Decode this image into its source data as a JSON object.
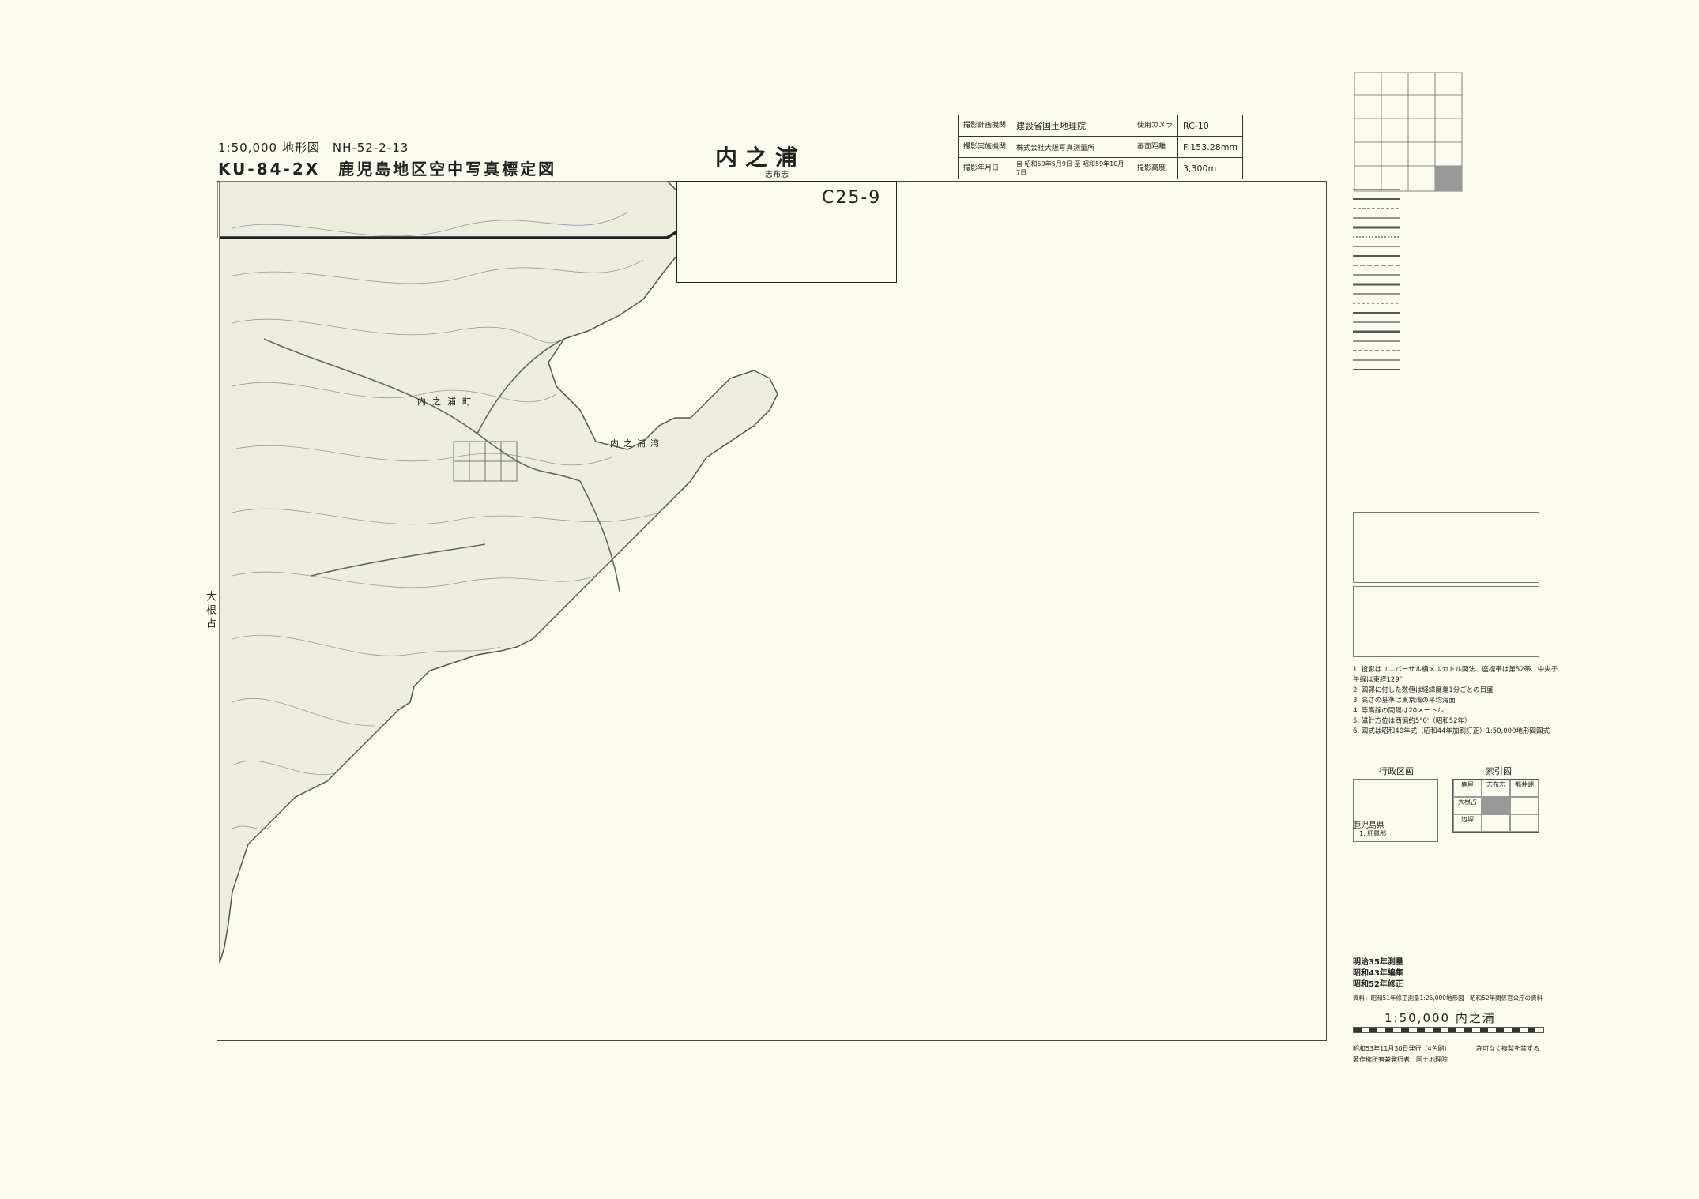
{
  "header": {
    "series_line": "1:50,000 地形図　NH-52-2-13",
    "code_line": "KU-84-2X　鹿児島地区空中写真標定図",
    "map_name": "内之浦",
    "map_name_reading": "志布志"
  },
  "photo_info": {
    "rows": [
      {
        "label": "撮影計画機関",
        "value": "建設省国土地理院",
        "label2": "使用カメラ",
        "value2": "RC-10"
      },
      {
        "label": "撮影実施機関",
        "value": "株式会社大阪写真測量所",
        "label2": "画面距離",
        "value2": "F:153.28mm"
      },
      {
        "label": "撮影年月日",
        "value": "自 昭和59年5月9日 至 昭和59年10月7日",
        "label2": "撮影高度",
        "value2": "3,300m"
      }
    ]
  },
  "map": {
    "sheet_code": "C25-9",
    "bay_label": "内之浦湾",
    "side_label": "大根占",
    "town_label": "内之浦町"
  },
  "notes": [
    "1. 投影はユニバーサル横メルカトル図法、座標帯は第52帯、中央子午線は東経129°",
    "2. 図郭に付した数値は経緯度差1分ごとの目盛",
    "3. 高さの基準は東京湾の平均海面",
    "4. 等高線の間隔は20メートル",
    "5. 磁針方位は西偏約5°0'（昭和52年）",
    "6. 図式は昭和40年式（昭和44年加刷訂正）1:50,000地形図図式"
  ],
  "admin": {
    "title": "行政区画",
    "prefecture": "鹿児島県",
    "sub": "1. 肝属郡"
  },
  "index_map": {
    "title": "索引図",
    "cells": [
      "鹿屋",
      "志布志",
      "都井岬",
      "大根占",
      "",
      "",
      "辺塚",
      "",
      ""
    ]
  },
  "history": [
    "明治35年測量",
    "昭和43年編集",
    "昭和52年修正"
  ],
  "history_note": "資料：昭和51年修正測量1:25,000地形図　昭和52年関係官公庁の資料",
  "footer": {
    "scale_title": "1:50,000 内之浦",
    "issue_line": "昭和53年11月30日発行（4色刷）",
    "publisher": "著作権所有兼発行者　国土地理院",
    "copyright": "許可なく複製を禁ずる"
  }
}
